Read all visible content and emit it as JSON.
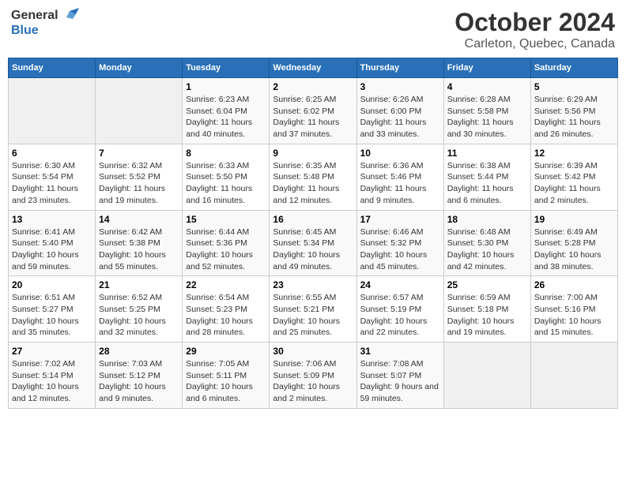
{
  "header": {
    "logo_general": "General",
    "logo_blue": "Blue",
    "title": "October 2024",
    "subtitle": "Carleton, Quebec, Canada"
  },
  "weekdays": [
    "Sunday",
    "Monday",
    "Tuesday",
    "Wednesday",
    "Thursday",
    "Friday",
    "Saturday"
  ],
  "weeks": [
    [
      {
        "day": "",
        "empty": true
      },
      {
        "day": "",
        "empty": true
      },
      {
        "day": "1",
        "sunrise": "Sunrise: 6:23 AM",
        "sunset": "Sunset: 6:04 PM",
        "daylight": "Daylight: 11 hours and 40 minutes."
      },
      {
        "day": "2",
        "sunrise": "Sunrise: 6:25 AM",
        "sunset": "Sunset: 6:02 PM",
        "daylight": "Daylight: 11 hours and 37 minutes."
      },
      {
        "day": "3",
        "sunrise": "Sunrise: 6:26 AM",
        "sunset": "Sunset: 6:00 PM",
        "daylight": "Daylight: 11 hours and 33 minutes."
      },
      {
        "day": "4",
        "sunrise": "Sunrise: 6:28 AM",
        "sunset": "Sunset: 5:58 PM",
        "daylight": "Daylight: 11 hours and 30 minutes."
      },
      {
        "day": "5",
        "sunrise": "Sunrise: 6:29 AM",
        "sunset": "Sunset: 5:56 PM",
        "daylight": "Daylight: 11 hours and 26 minutes."
      }
    ],
    [
      {
        "day": "6",
        "sunrise": "Sunrise: 6:30 AM",
        "sunset": "Sunset: 5:54 PM",
        "daylight": "Daylight: 11 hours and 23 minutes."
      },
      {
        "day": "7",
        "sunrise": "Sunrise: 6:32 AM",
        "sunset": "Sunset: 5:52 PM",
        "daylight": "Daylight: 11 hours and 19 minutes."
      },
      {
        "day": "8",
        "sunrise": "Sunrise: 6:33 AM",
        "sunset": "Sunset: 5:50 PM",
        "daylight": "Daylight: 11 hours and 16 minutes."
      },
      {
        "day": "9",
        "sunrise": "Sunrise: 6:35 AM",
        "sunset": "Sunset: 5:48 PM",
        "daylight": "Daylight: 11 hours and 12 minutes."
      },
      {
        "day": "10",
        "sunrise": "Sunrise: 6:36 AM",
        "sunset": "Sunset: 5:46 PM",
        "daylight": "Daylight: 11 hours and 9 minutes."
      },
      {
        "day": "11",
        "sunrise": "Sunrise: 6:38 AM",
        "sunset": "Sunset: 5:44 PM",
        "daylight": "Daylight: 11 hours and 6 minutes."
      },
      {
        "day": "12",
        "sunrise": "Sunrise: 6:39 AM",
        "sunset": "Sunset: 5:42 PM",
        "daylight": "Daylight: 11 hours and 2 minutes."
      }
    ],
    [
      {
        "day": "13",
        "sunrise": "Sunrise: 6:41 AM",
        "sunset": "Sunset: 5:40 PM",
        "daylight": "Daylight: 10 hours and 59 minutes."
      },
      {
        "day": "14",
        "sunrise": "Sunrise: 6:42 AM",
        "sunset": "Sunset: 5:38 PM",
        "daylight": "Daylight: 10 hours and 55 minutes."
      },
      {
        "day": "15",
        "sunrise": "Sunrise: 6:44 AM",
        "sunset": "Sunset: 5:36 PM",
        "daylight": "Daylight: 10 hours and 52 minutes."
      },
      {
        "day": "16",
        "sunrise": "Sunrise: 6:45 AM",
        "sunset": "Sunset: 5:34 PM",
        "daylight": "Daylight: 10 hours and 49 minutes."
      },
      {
        "day": "17",
        "sunrise": "Sunrise: 6:46 AM",
        "sunset": "Sunset: 5:32 PM",
        "daylight": "Daylight: 10 hours and 45 minutes."
      },
      {
        "day": "18",
        "sunrise": "Sunrise: 6:48 AM",
        "sunset": "Sunset: 5:30 PM",
        "daylight": "Daylight: 10 hours and 42 minutes."
      },
      {
        "day": "19",
        "sunrise": "Sunrise: 6:49 AM",
        "sunset": "Sunset: 5:28 PM",
        "daylight": "Daylight: 10 hours and 38 minutes."
      }
    ],
    [
      {
        "day": "20",
        "sunrise": "Sunrise: 6:51 AM",
        "sunset": "Sunset: 5:27 PM",
        "daylight": "Daylight: 10 hours and 35 minutes."
      },
      {
        "day": "21",
        "sunrise": "Sunrise: 6:52 AM",
        "sunset": "Sunset: 5:25 PM",
        "daylight": "Daylight: 10 hours and 32 minutes."
      },
      {
        "day": "22",
        "sunrise": "Sunrise: 6:54 AM",
        "sunset": "Sunset: 5:23 PM",
        "daylight": "Daylight: 10 hours and 28 minutes."
      },
      {
        "day": "23",
        "sunrise": "Sunrise: 6:55 AM",
        "sunset": "Sunset: 5:21 PM",
        "daylight": "Daylight: 10 hours and 25 minutes."
      },
      {
        "day": "24",
        "sunrise": "Sunrise: 6:57 AM",
        "sunset": "Sunset: 5:19 PM",
        "daylight": "Daylight: 10 hours and 22 minutes."
      },
      {
        "day": "25",
        "sunrise": "Sunrise: 6:59 AM",
        "sunset": "Sunset: 5:18 PM",
        "daylight": "Daylight: 10 hours and 19 minutes."
      },
      {
        "day": "26",
        "sunrise": "Sunrise: 7:00 AM",
        "sunset": "Sunset: 5:16 PM",
        "daylight": "Daylight: 10 hours and 15 minutes."
      }
    ],
    [
      {
        "day": "27",
        "sunrise": "Sunrise: 7:02 AM",
        "sunset": "Sunset: 5:14 PM",
        "daylight": "Daylight: 10 hours and 12 minutes."
      },
      {
        "day": "28",
        "sunrise": "Sunrise: 7:03 AM",
        "sunset": "Sunset: 5:12 PM",
        "daylight": "Daylight: 10 hours and 9 minutes."
      },
      {
        "day": "29",
        "sunrise": "Sunrise: 7:05 AM",
        "sunset": "Sunset: 5:11 PM",
        "daylight": "Daylight: 10 hours and 6 minutes."
      },
      {
        "day": "30",
        "sunrise": "Sunrise: 7:06 AM",
        "sunset": "Sunset: 5:09 PM",
        "daylight": "Daylight: 10 hours and 2 minutes."
      },
      {
        "day": "31",
        "sunrise": "Sunrise: 7:08 AM",
        "sunset": "Sunset: 5:07 PM",
        "daylight": "Daylight: 9 hours and 59 minutes."
      },
      {
        "day": "",
        "empty": true
      },
      {
        "day": "",
        "empty": true
      }
    ]
  ]
}
